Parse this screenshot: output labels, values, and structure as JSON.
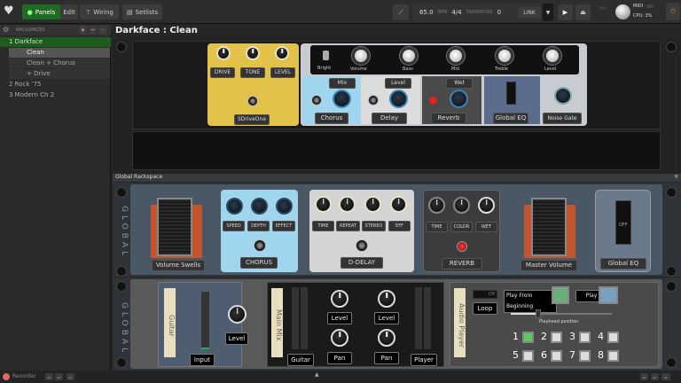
{
  "toolbar": {
    "panels": "Panels",
    "edit": "Edit",
    "wiring": "Wiring",
    "setlists": "Setlists",
    "bpm": "65.0",
    "bpm_unit": "BPM",
    "time_sig": "4/4",
    "transpose_label": "TRANSPOSE",
    "transpose": "0",
    "link": "LINK",
    "trim_label": "TRIM",
    "midi": "MIDI",
    "cpu": "CPU: 3%"
  },
  "sidebar": {
    "header": "RACKSPACES",
    "add": "+",
    "remove": "−",
    "more": "···",
    "items": [
      {
        "label": "1  Darkface"
      },
      {
        "label": "Clean"
      },
      {
        "label": "Clean + Chorus"
      },
      {
        "label": "+ Drive"
      },
      {
        "label": "2  Rock '75"
      },
      {
        "label": "3  Modern Ch 2"
      }
    ]
  },
  "main": {
    "title": "Darkface : Clean"
  },
  "rack": {
    "drive": {
      "knobs": [
        "DRIVE",
        "TONE",
        "LEVEL"
      ],
      "name": "SDriveOne"
    },
    "amp": {
      "switch": "Bright",
      "knobs": [
        "Volume",
        "Bass",
        "Mid",
        "Treble",
        "Level"
      ]
    },
    "chorus": {
      "param": "Mix",
      "name": "Chorus"
    },
    "delay": {
      "param": "Level",
      "name": "Delay"
    },
    "reverb": {
      "param": "Wet",
      "name": "Reverb"
    },
    "eq": {
      "name": "Global EQ"
    },
    "gate": {
      "name": "Noise Gate"
    }
  },
  "global": {
    "bar": "Global Rackspace",
    "side": "GLOBAL",
    "swell": "Volume Swells",
    "chorus": {
      "knobs": [
        "SPEED",
        "DEPTH",
        "EFFECT"
      ],
      "name": "CHORUS"
    },
    "ddelay": {
      "knobs": [
        "TIME",
        "REPEAT",
        "STEREO",
        "EFF"
      ],
      "name": "D-DELAY"
    },
    "reverb": {
      "knobs": [
        "TIME",
        "COLOR",
        "WET"
      ],
      "name": "REVERB"
    },
    "master": "Master Volume",
    "eq": {
      "state": "OFF",
      "name": "Global EQ"
    }
  },
  "global2": {
    "side": "GLOBAL",
    "guitar": {
      "ribbon": "Guitar",
      "input": "Input",
      "level": "Level"
    },
    "mix": {
      "ribbon": "Main Mix",
      "level1": "Level",
      "level2": "Level",
      "pan1": "Pan",
      "pan2": "Pan",
      "ch1": "Guitar",
      "ch2": "Player"
    },
    "player": {
      "ribbon": "Audio Player",
      "toggle": "Off",
      "loop": "Loop",
      "play_begin": "Play From Beginning",
      "play": "Play",
      "playhead_label": "Playhead position",
      "playhead": 0.27,
      "slots": [
        "1",
        "2",
        "3",
        "4",
        "5",
        "6",
        "7",
        "8"
      ]
    }
  },
  "status": {
    "recorder": "Recorder"
  },
  "colors": {
    "accent": "#1e6b22",
    "drive": "#e3c24a",
    "chorus": "#9fd6ee",
    "eq": "#5b6b8c"
  }
}
